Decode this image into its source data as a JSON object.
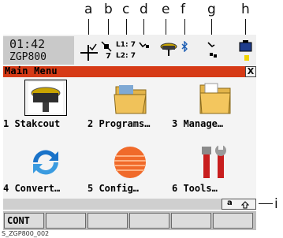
{
  "callouts": [
    "a",
    "b",
    "c",
    "d",
    "e",
    "f",
    "g",
    "h",
    "i"
  ],
  "status": {
    "time": "01:42",
    "instrument": "ZGP800",
    "sat_count_b": "7",
    "l1_label": "L1: 7",
    "l2_label": "L2: 7"
  },
  "title": "Main Menu",
  "close_label": "X",
  "menu_items": [
    {
      "label": "1 Stakcout",
      "icon": "receiver-icon"
    },
    {
      "label": "2 Programs…",
      "icon": "folder-icon"
    },
    {
      "label": "3 Manage…",
      "icon": "folder-icon"
    },
    {
      "label": "4 Convert…",
      "icon": "convert-arrows-icon"
    },
    {
      "label": "5 Config…",
      "icon": "config-sphere-icon"
    },
    {
      "label": "6 Tools…",
      "icon": "tools-icon"
    }
  ],
  "input_mode": {
    "label": "a"
  },
  "softkeys": [
    "CONT",
    "",
    "",
    "",
    "",
    ""
  ],
  "caption": "S_ZGP800_002",
  "colors": {
    "title_bar": "#d63a16",
    "status_bg": "#c9c9c9"
  }
}
